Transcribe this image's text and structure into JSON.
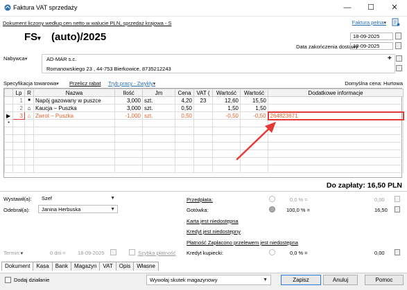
{
  "window": {
    "title": "Faktura VAT sprzedaży",
    "minimize": "—",
    "maximize": "☐",
    "close": "✕"
  },
  "header": {
    "info_line": "Dokument liczony według cen netto w walucie PLN, sprzedaż krajowa - S",
    "faktura_type": "Faktura pełna",
    "doc_type": "FS",
    "doc_number": "(auto)/2025",
    "issue_date": "18-09-2025",
    "delivery_date_label": "Data zakończenia dostawy",
    "delivery_date": "18-09-2025"
  },
  "buyer": {
    "label": "Nabywca",
    "name": "AD-MAR s.c.",
    "address": "Romanowskiego 23 , 44-753 Bierkowice, 8735212243"
  },
  "spec_bar": {
    "specification": "Specyfikacja towarowa",
    "recalc": "Przelicz rabat",
    "work_mode": "Tryb pracy - Zwykły",
    "default_price": "Domyślna cena: Hurtowa"
  },
  "table": {
    "columns": [
      "Lp",
      "R",
      "Nazwa",
      "Ilość",
      "Jm",
      "Cena",
      "VAT (",
      "Wartość",
      "Wartość",
      "Dodatkowe informacje"
    ],
    "rows": [
      {
        "lp": "1",
        "r": "■",
        "name": "Napój gazowany w puszce",
        "qty": "3,000",
        "unit": "szt.",
        "price": "4,20",
        "vat": "23",
        "net": "12,60",
        "gross": "15,50",
        "info": ""
      },
      {
        "lp": "2",
        "r": "⌂",
        "name": "Kaucja – Puszka",
        "qty": "3,000",
        "unit": "szt.",
        "price": "0,50",
        "vat": "",
        "net": "1,50",
        "gross": "1,50",
        "info": ""
      },
      {
        "lp": "3",
        "r": "⌂",
        "name": "Zwrot – Puszka",
        "qty": "-1,000",
        "unit": "szt.",
        "price": "0,50",
        "vat": "",
        "net": "-0,50",
        "gross": "-0,50",
        "info": "264823671"
      }
    ],
    "new_row_marker": "*"
  },
  "totals": {
    "to_pay": "Do zapłaty: 16,50 PLN"
  },
  "people": {
    "issued_label": "Wystawił(a):",
    "issued_value": "Szef",
    "received_label": "Odebrał(a):",
    "received_value": "Janina Herbuska"
  },
  "payment": {
    "prepayment_label": "Przedpłata:",
    "prepayment_pct": "0,0 % =",
    "prepayment_value": "0,00",
    "cash_label": "Gotówka:",
    "cash_pct": "100,0 % =",
    "cash_value": "16,50",
    "card": "Karta jest niedostępna",
    "credit": "Kredyt jest niedostępny",
    "transfer": "Płatność Zapłacono przelewem jest niedostępna",
    "buyer_credit_label": "Kredyt kupiecki:",
    "buyer_credit_pct": "0,0 % =",
    "buyer_credit_value": "0,00"
  },
  "term": {
    "label": "Termin:",
    "days": "0 dni =",
    "date": "18-09-2025",
    "fast_payment": "Szybka płatność"
  },
  "tabs": [
    "Dokument",
    "Kasa",
    "Bank",
    "Magazyn",
    "VAT",
    "Opis",
    "Własne"
  ],
  "footer": {
    "add_action": "Dodaj działanie",
    "warehouse_effect": "Wywołaj skutek magazynowy",
    "save": "Zapisz",
    "cancel": "Anuluj",
    "help": "Pomoc"
  },
  "colors": {
    "link": "#2a6db5",
    "negative_row": "#e0622a",
    "highlight": "#e53935"
  }
}
